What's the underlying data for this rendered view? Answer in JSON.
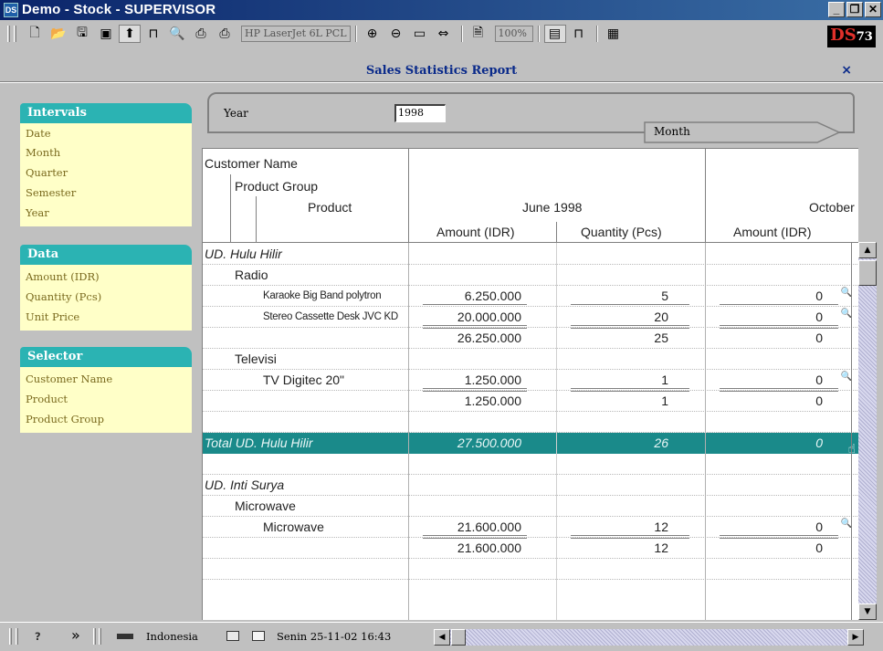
{
  "window": {
    "app_icon_text": "DS",
    "title": "Demo - Stock - SUPERVISOR",
    "minimize": "_",
    "maximize": "❐",
    "close": "✕"
  },
  "toolbar": {
    "buttons": [
      "new-icon",
      "open-icon",
      "save-icon",
      "save-as-icon",
      "export-icon",
      "page-icon",
      "preview-icon",
      "print-icon",
      "printer-setup-icon",
      "zoom-in-icon",
      "zoom-out-icon",
      "zoom-fit-icon",
      "zoom-width-icon",
      "page-setup-icon",
      "layout-1-icon",
      "layout-2-icon",
      "layout-3-icon"
    ],
    "printer": "HP LaserJet 6L PCL",
    "zoom": "100%",
    "logo": {
      "text": "DS",
      "number": "73"
    }
  },
  "report": {
    "title": "Sales Statistics Report",
    "close_label": "×"
  },
  "panels": {
    "intervals": {
      "title": "Intervals",
      "items": [
        "Date",
        "Month",
        "Quarter",
        "Semester",
        "Year"
      ]
    },
    "data": {
      "title": "Data",
      "items": [
        "Amount (IDR)",
        "Quantity (Pcs)",
        "Unit Price"
      ]
    },
    "selector": {
      "title": "Selector",
      "items": [
        "Customer Name",
        "Product",
        "Product Group"
      ]
    }
  },
  "filters": {
    "year_label": "Year",
    "year_value": "1998",
    "month_label": "Month"
  },
  "grid": {
    "headers": {
      "customer": "Customer Name",
      "group": "Product Group",
      "product": "Product",
      "period1": "June 1998",
      "period2": "October",
      "amount": "Amount (IDR)",
      "quantity": "Quantity (Pcs)",
      "amount2": "Amount (IDR)"
    },
    "rows": [
      {
        "type": "customer",
        "label": "UD. Hulu Hilir",
        "amount": "",
        "qty": "",
        "amount2": ""
      },
      {
        "type": "group",
        "label": "Radio",
        "amount": "",
        "qty": "",
        "amount2": ""
      },
      {
        "type": "product-small",
        "label": "Karaoke Big Band polytron",
        "amount": "6.250.000",
        "qty": "5",
        "amount2": "0"
      },
      {
        "type": "product-small",
        "label": "Stereo Cassette Desk JVC KD",
        "amount": "20.000.000",
        "qty": "20",
        "amount2": "0"
      },
      {
        "type": "subtotal",
        "label": "",
        "amount": "26.250.000",
        "qty": "25",
        "amount2": "0"
      },
      {
        "type": "group",
        "label": "Televisi",
        "amount": "",
        "qty": "",
        "amount2": ""
      },
      {
        "type": "product",
        "label": "TV Digitec 20\"",
        "amount": "1.250.000",
        "qty": "1",
        "amount2": "0"
      },
      {
        "type": "subtotal",
        "label": "",
        "amount": "1.250.000",
        "qty": "1",
        "amount2": "0"
      },
      {
        "type": "blank",
        "label": "",
        "amount": "",
        "qty": "",
        "amount2": ""
      },
      {
        "type": "total",
        "label": "Total UD. Hulu Hilir",
        "amount": "27.500.000",
        "qty": "26",
        "amount2": "0"
      },
      {
        "type": "blank",
        "label": "",
        "amount": "",
        "qty": "",
        "amount2": ""
      },
      {
        "type": "customer",
        "label": "UD. Inti Surya",
        "amount": "",
        "qty": "",
        "amount2": ""
      },
      {
        "type": "group",
        "label": "Microwave",
        "amount": "",
        "qty": "",
        "amount2": ""
      },
      {
        "type": "product",
        "label": "Microwave",
        "amount": "21.600.000",
        "qty": "12",
        "amount2": "0"
      },
      {
        "type": "subtotal",
        "label": "",
        "amount": "21.600.000",
        "qty": "12",
        "amount2": "0"
      },
      {
        "type": "blank",
        "label": "",
        "amount": "",
        "qty": "",
        "amount2": ""
      }
    ]
  },
  "statusbar": {
    "help_icon": "?",
    "more": "»",
    "language": "Indonesia",
    "datetime": "Senin 25-11-02  16:43"
  },
  "colors": {
    "accent": "#2bb3b3",
    "panel_bg": "#ffffc8",
    "total_row": "#1a8a8a",
    "title_bar": "#0a246a"
  }
}
